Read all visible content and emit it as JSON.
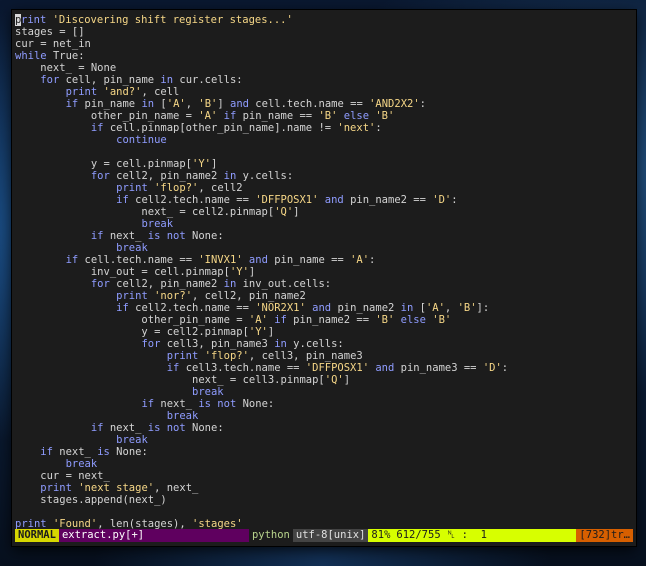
{
  "editor": {
    "lines": [
      [
        {
          "t": "print ",
          "c": "kw"
        },
        {
          "t": "'Discovering shift register stages...'",
          "c": "str"
        }
      ],
      [
        {
          "t": "stages = []",
          "c": "plain"
        }
      ],
      [
        {
          "t": "cur = net_in",
          "c": "plain"
        }
      ],
      [
        {
          "t": "while ",
          "c": "kw"
        },
        {
          "t": "True:",
          "c": "plain"
        }
      ],
      [
        {
          "t": "    next_ = None",
          "c": "plain"
        }
      ],
      [
        {
          "t": "    ",
          "c": "plain"
        },
        {
          "t": "for ",
          "c": "kw"
        },
        {
          "t": "cell, pin_name ",
          "c": "plain"
        },
        {
          "t": "in ",
          "c": "kw"
        },
        {
          "t": "cur.cells:",
          "c": "plain"
        }
      ],
      [
        {
          "t": "        ",
          "c": "plain"
        },
        {
          "t": "print ",
          "c": "kw"
        },
        {
          "t": "'and?'",
          "c": "str"
        },
        {
          "t": ", cell",
          "c": "plain"
        }
      ],
      [
        {
          "t": "        ",
          "c": "plain"
        },
        {
          "t": "if ",
          "c": "kw"
        },
        {
          "t": "pin_name ",
          "c": "plain"
        },
        {
          "t": "in ",
          "c": "kw"
        },
        {
          "t": "[",
          "c": "plain"
        },
        {
          "t": "'A'",
          "c": "str"
        },
        {
          "t": ", ",
          "c": "plain"
        },
        {
          "t": "'B'",
          "c": "str"
        },
        {
          "t": "] ",
          "c": "plain"
        },
        {
          "t": "and ",
          "c": "kw"
        },
        {
          "t": "cell.tech.name == ",
          "c": "plain"
        },
        {
          "t": "'AND2X2'",
          "c": "str"
        },
        {
          "t": ":",
          "c": "plain"
        }
      ],
      [
        {
          "t": "            other_pin_name = ",
          "c": "plain"
        },
        {
          "t": "'A' ",
          "c": "str"
        },
        {
          "t": "if ",
          "c": "kw"
        },
        {
          "t": "pin_name == ",
          "c": "plain"
        },
        {
          "t": "'B' ",
          "c": "str"
        },
        {
          "t": "else ",
          "c": "kw"
        },
        {
          "t": "'B'",
          "c": "str"
        }
      ],
      [
        {
          "t": "            ",
          "c": "plain"
        },
        {
          "t": "if ",
          "c": "kw"
        },
        {
          "t": "cell.pinmap[other_pin_name].name != ",
          "c": "plain"
        },
        {
          "t": "'next'",
          "c": "str"
        },
        {
          "t": ":",
          "c": "plain"
        }
      ],
      [
        {
          "t": "                ",
          "c": "plain"
        },
        {
          "t": "continue",
          "c": "kw"
        }
      ],
      [
        {
          "t": "",
          "c": "plain"
        }
      ],
      [
        {
          "t": "            y = cell.pinmap[",
          "c": "plain"
        },
        {
          "t": "'Y'",
          "c": "str"
        },
        {
          "t": "]",
          "c": "plain"
        }
      ],
      [
        {
          "t": "            ",
          "c": "plain"
        },
        {
          "t": "for ",
          "c": "kw"
        },
        {
          "t": "cell2, pin_name2 ",
          "c": "plain"
        },
        {
          "t": "in ",
          "c": "kw"
        },
        {
          "t": "y.cells:",
          "c": "plain"
        }
      ],
      [
        {
          "t": "                ",
          "c": "plain"
        },
        {
          "t": "print ",
          "c": "kw"
        },
        {
          "t": "'flop?'",
          "c": "str"
        },
        {
          "t": ", cell2",
          "c": "plain"
        }
      ],
      [
        {
          "t": "                ",
          "c": "plain"
        },
        {
          "t": "if ",
          "c": "kw"
        },
        {
          "t": "cell2.tech.name == ",
          "c": "plain"
        },
        {
          "t": "'DFFPOSX1' ",
          "c": "str"
        },
        {
          "t": "and ",
          "c": "kw"
        },
        {
          "t": "pin_name2 == ",
          "c": "plain"
        },
        {
          "t": "'D'",
          "c": "str"
        },
        {
          "t": ":",
          "c": "plain"
        }
      ],
      [
        {
          "t": "                    next_ = cell2.pinmap[",
          "c": "plain"
        },
        {
          "t": "'Q'",
          "c": "str"
        },
        {
          "t": "]",
          "c": "plain"
        }
      ],
      [
        {
          "t": "                    ",
          "c": "plain"
        },
        {
          "t": "break",
          "c": "kw"
        }
      ],
      [
        {
          "t": "            ",
          "c": "plain"
        },
        {
          "t": "if ",
          "c": "kw"
        },
        {
          "t": "next_ ",
          "c": "plain"
        },
        {
          "t": "is not ",
          "c": "kw"
        },
        {
          "t": "None:",
          "c": "plain"
        }
      ],
      [
        {
          "t": "                ",
          "c": "plain"
        },
        {
          "t": "break",
          "c": "kw"
        }
      ],
      [
        {
          "t": "        ",
          "c": "plain"
        },
        {
          "t": "if ",
          "c": "kw"
        },
        {
          "t": "cell.tech.name == ",
          "c": "plain"
        },
        {
          "t": "'INVX1' ",
          "c": "str"
        },
        {
          "t": "and ",
          "c": "kw"
        },
        {
          "t": "pin_name == ",
          "c": "plain"
        },
        {
          "t": "'A'",
          "c": "str"
        },
        {
          "t": ":",
          "c": "plain"
        }
      ],
      [
        {
          "t": "            inv_out = cell.pinmap[",
          "c": "plain"
        },
        {
          "t": "'Y'",
          "c": "str"
        },
        {
          "t": "]",
          "c": "plain"
        }
      ],
      [
        {
          "t": "            ",
          "c": "plain"
        },
        {
          "t": "for ",
          "c": "kw"
        },
        {
          "t": "cell2, pin_name2 ",
          "c": "plain"
        },
        {
          "t": "in ",
          "c": "kw"
        },
        {
          "t": "inv_out.cells:",
          "c": "plain"
        }
      ],
      [
        {
          "t": "                ",
          "c": "plain"
        },
        {
          "t": "print ",
          "c": "kw"
        },
        {
          "t": "'nor?'",
          "c": "str"
        },
        {
          "t": ", cell2, pin_name2",
          "c": "plain"
        }
      ],
      [
        {
          "t": "                ",
          "c": "plain"
        },
        {
          "t": "if ",
          "c": "kw"
        },
        {
          "t": "cell2.tech.name == ",
          "c": "plain"
        },
        {
          "t": "'NOR2X1' ",
          "c": "str"
        },
        {
          "t": "and ",
          "c": "kw"
        },
        {
          "t": "pin_name2 ",
          "c": "plain"
        },
        {
          "t": "in ",
          "c": "kw"
        },
        {
          "t": "[",
          "c": "plain"
        },
        {
          "t": "'A'",
          "c": "str"
        },
        {
          "t": ", ",
          "c": "plain"
        },
        {
          "t": "'B'",
          "c": "str"
        },
        {
          "t": "]:",
          "c": "plain"
        }
      ],
      [
        {
          "t": "                    other_pin_name = ",
          "c": "plain"
        },
        {
          "t": "'A' ",
          "c": "str"
        },
        {
          "t": "if ",
          "c": "kw"
        },
        {
          "t": "pin_name2 == ",
          "c": "plain"
        },
        {
          "t": "'B' ",
          "c": "str"
        },
        {
          "t": "else ",
          "c": "kw"
        },
        {
          "t": "'B'",
          "c": "str"
        }
      ],
      [
        {
          "t": "                    y = cell2.pinmap[",
          "c": "plain"
        },
        {
          "t": "'Y'",
          "c": "str"
        },
        {
          "t": "]",
          "c": "plain"
        }
      ],
      [
        {
          "t": "                    ",
          "c": "plain"
        },
        {
          "t": "for ",
          "c": "kw"
        },
        {
          "t": "cell3, pin_name3 ",
          "c": "plain"
        },
        {
          "t": "in ",
          "c": "kw"
        },
        {
          "t": "y.cells:",
          "c": "plain"
        }
      ],
      [
        {
          "t": "                        ",
          "c": "plain"
        },
        {
          "t": "print ",
          "c": "kw"
        },
        {
          "t": "'flop?'",
          "c": "str"
        },
        {
          "t": ", cell3, pin_name3",
          "c": "plain"
        }
      ],
      [
        {
          "t": "                        ",
          "c": "plain"
        },
        {
          "t": "if ",
          "c": "kw"
        },
        {
          "t": "cell3.tech.name == ",
          "c": "plain"
        },
        {
          "t": "'DFFPOSX1' ",
          "c": "str"
        },
        {
          "t": "and ",
          "c": "kw"
        },
        {
          "t": "pin_name3 == ",
          "c": "plain"
        },
        {
          "t": "'D'",
          "c": "str"
        },
        {
          "t": ":",
          "c": "plain"
        }
      ],
      [
        {
          "t": "                            next_ = cell3.pinmap[",
          "c": "plain"
        },
        {
          "t": "'Q'",
          "c": "str"
        },
        {
          "t": "]",
          "c": "plain"
        }
      ],
      [
        {
          "t": "                            ",
          "c": "plain"
        },
        {
          "t": "break",
          "c": "kw"
        }
      ],
      [
        {
          "t": "                    ",
          "c": "plain"
        },
        {
          "t": "if ",
          "c": "kw"
        },
        {
          "t": "next_ ",
          "c": "plain"
        },
        {
          "t": "is not ",
          "c": "kw"
        },
        {
          "t": "None:",
          "c": "plain"
        }
      ],
      [
        {
          "t": "                        ",
          "c": "plain"
        },
        {
          "t": "break",
          "c": "kw"
        }
      ],
      [
        {
          "t": "            ",
          "c": "plain"
        },
        {
          "t": "if ",
          "c": "kw"
        },
        {
          "t": "next_ ",
          "c": "plain"
        },
        {
          "t": "is not ",
          "c": "kw"
        },
        {
          "t": "None:",
          "c": "plain"
        }
      ],
      [
        {
          "t": "                ",
          "c": "plain"
        },
        {
          "t": "break",
          "c": "kw"
        }
      ],
      [
        {
          "t": "    ",
          "c": "plain"
        },
        {
          "t": "if ",
          "c": "kw"
        },
        {
          "t": "next_ ",
          "c": "plain"
        },
        {
          "t": "is ",
          "c": "kw"
        },
        {
          "t": "None:",
          "c": "plain"
        }
      ],
      [
        {
          "t": "        ",
          "c": "plain"
        },
        {
          "t": "break",
          "c": "kw"
        }
      ],
      [
        {
          "t": "    cur = next_",
          "c": "plain"
        }
      ],
      [
        {
          "t": "    ",
          "c": "plain"
        },
        {
          "t": "print ",
          "c": "kw"
        },
        {
          "t": "'next stage'",
          "c": "str"
        },
        {
          "t": ", next_",
          "c": "plain"
        }
      ],
      [
        {
          "t": "    stages.append(next_)",
          "c": "plain"
        }
      ],
      [
        {
          "t": "",
          "c": "plain"
        }
      ],
      [
        {
          "t": "print ",
          "c": "kw"
        },
        {
          "t": "'Found'",
          "c": "str"
        },
        {
          "t": ", len(stages), ",
          "c": "plain"
        },
        {
          "t": "'stages'",
          "c": "str"
        }
      ]
    ]
  },
  "statusline": {
    "mode": "NORMAL",
    "file": "extract.py[+]",
    "filetype": "python",
    "encoding": "utf-8[unix]",
    "percent": "81%",
    "position": "612/755 ␤ :  1",
    "warning": "[732]tr…"
  },
  "colors": {
    "keyword": "#8f9cff",
    "string": "#f6d787",
    "text": "#d4d4d4",
    "mode_bg": "#d7d700",
    "file_bg": "#5f005f",
    "position_bg": "#d7ff00",
    "warning_bg": "#d75f00"
  }
}
